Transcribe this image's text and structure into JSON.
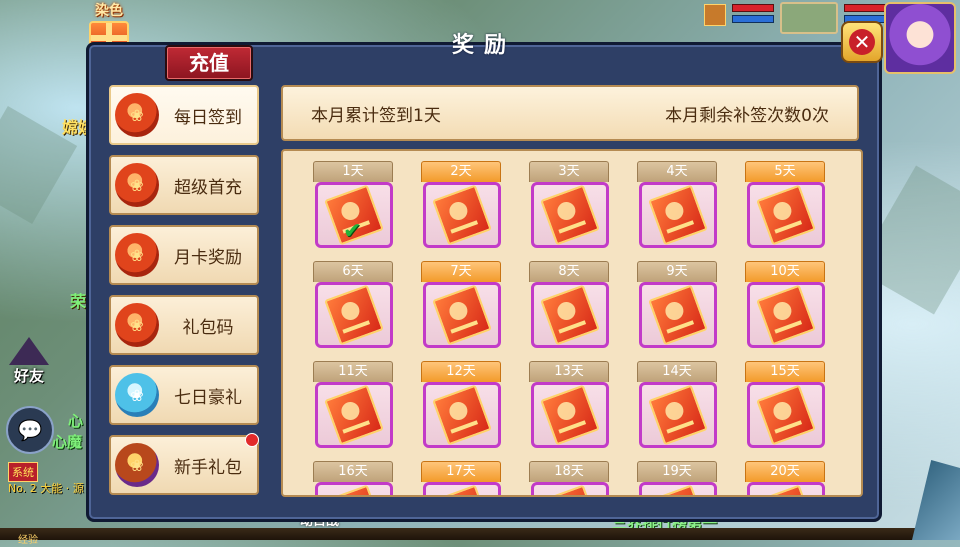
{
  "hud": {
    "dye_label": "染色",
    "left_name_partial": "嫦娥",
    "left_char_partial": "荣",
    "friend_label": "好友",
    "heart_text_1": "心",
    "heart_text_2": "心魔",
    "system_tag": "系统",
    "system_line": "No. 2 大能 · 源",
    "bottom_center_partial": "动目战",
    "ranking_text": "三界排行榜第一",
    "exp_label": "经验"
  },
  "panel": {
    "title": "奖励",
    "recharge_label": "充值",
    "close_icon": "close-x-icon"
  },
  "menu": [
    {
      "label": "每日签到",
      "icon": "red-pouch-icon",
      "active": true
    },
    {
      "label": "超级首充",
      "icon": "gold-bag-icon"
    },
    {
      "label": "月卡奖励",
      "icon": "gold-bag-icon"
    },
    {
      "label": "礼包码",
      "icon": "gold-bag-icon"
    },
    {
      "label": "七日豪礼",
      "icon": "blue-bag-icon"
    },
    {
      "label": "新手礼包",
      "icon": "treasure-icon",
      "badge": true
    }
  ],
  "info": {
    "signed_text": "本月累计签到1天",
    "makeup_text": "本月剩余补签次数0次"
  },
  "days": [
    {
      "label": "1天",
      "highlight": false,
      "claimed": true
    },
    {
      "label": "2天",
      "highlight": true
    },
    {
      "label": "3天",
      "highlight": false
    },
    {
      "label": "4天",
      "highlight": false
    },
    {
      "label": "5天",
      "highlight": true
    },
    {
      "label": "6天",
      "highlight": false
    },
    {
      "label": "7天",
      "highlight": true
    },
    {
      "label": "8天",
      "highlight": false
    },
    {
      "label": "9天",
      "highlight": false
    },
    {
      "label": "10天",
      "highlight": true
    },
    {
      "label": "11天",
      "highlight": false
    },
    {
      "label": "12天",
      "highlight": true
    },
    {
      "label": "13天",
      "highlight": false
    },
    {
      "label": "14天",
      "highlight": false
    },
    {
      "label": "15天",
      "highlight": true
    },
    {
      "label": "16天",
      "highlight": false
    },
    {
      "label": "17天",
      "highlight": true
    },
    {
      "label": "18天",
      "highlight": false
    },
    {
      "label": "19天",
      "highlight": false
    },
    {
      "label": "20天",
      "highlight": true
    }
  ]
}
